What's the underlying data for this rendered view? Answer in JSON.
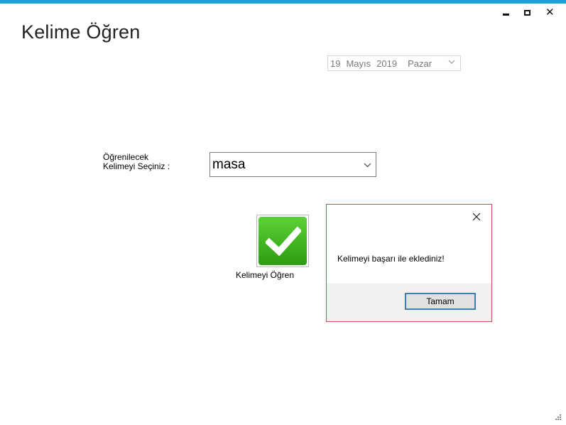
{
  "window": {
    "title": "Kelime Öğren",
    "controls": {
      "minimize": "minimize",
      "maximize": "maximize",
      "close": "close"
    }
  },
  "date_picker": {
    "day": "19",
    "month": "Mayıs",
    "year": "2019",
    "weekday": "Pazar"
  },
  "word_select": {
    "label": "Öğrenilecek\nKelimeyi Seçiniz :",
    "selected": "masa"
  },
  "learn_button": {
    "label": "Kelimeyi Öğren",
    "icon": "checkmark-icon"
  },
  "message_box": {
    "text": "Kelimeyi başarı ile eklediniz!",
    "ok_label": "Tamam"
  },
  "colors": {
    "title_bar_accent": "#1e9fd8",
    "dialog_border": "#c94c4c",
    "ok_button_border": "#3c7fb1",
    "check_green": "#3fb21e"
  }
}
